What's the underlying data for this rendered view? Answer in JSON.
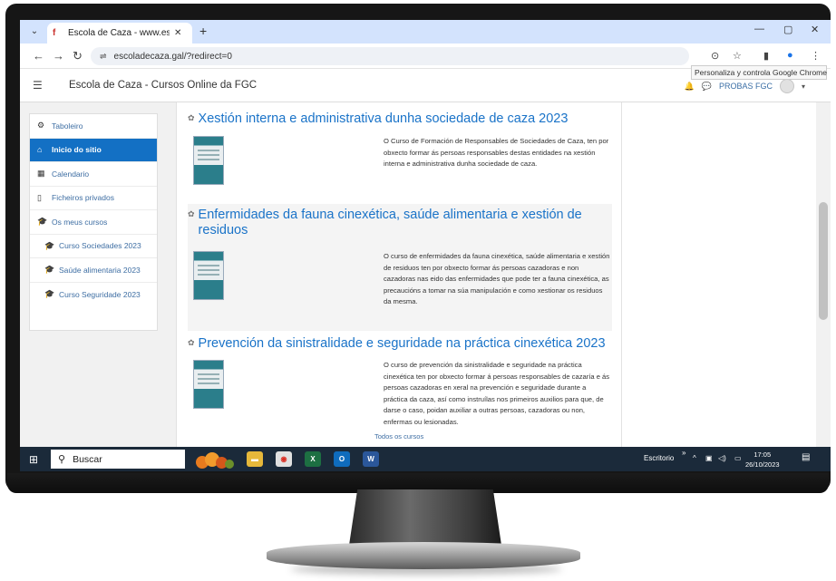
{
  "browser": {
    "tab_title": "Escola de Caza - www.escolad",
    "url": "escoladecaza.gal/?redirect=0",
    "tooltip": "Personaliza y controla Google Chrome"
  },
  "navbar": {
    "site_name": "Escola de Caza - Cursos Online da FGC",
    "user": "PROBAS FGC"
  },
  "sidebar": {
    "items": [
      {
        "label": "Taboleiro",
        "icon": "dashboard-icon"
      },
      {
        "label": "Inicio do sitio",
        "icon": "home-icon"
      },
      {
        "label": "Calendario",
        "icon": "calendar-icon"
      },
      {
        "label": "Ficheiros privados",
        "icon": "file-icon"
      },
      {
        "label": "Os meus cursos",
        "icon": "graduation-cap-icon"
      },
      {
        "label": "Curso Sociedades 2023",
        "icon": "graduation-cap-icon"
      },
      {
        "label": "Saúde alimentaria 2023",
        "icon": "graduation-cap-icon"
      },
      {
        "label": "Curso Seguridade 2023",
        "icon": "graduation-cap-icon"
      }
    ]
  },
  "courses": [
    {
      "title": "Xestión interna e administrativa dunha sociedade de caza 2023",
      "summary": "O Curso de Formación de Responsables de Sociedades de Caza, ten por obxecto formar ás persoas responsables destas entidades na xestión interna e administrativa dunha sociedade de caza."
    },
    {
      "title": "Enfermidades da fauna cinexética, saúde alimentaria e xestión de residuos",
      "summary": "O curso de enfermidades da fauna cinexética, saúde alimentaria e xestión de residuos ten por obxecto formar ás persoas cazadoras e non cazadoras nas eido das enfermidades que pode ter a fauna cinexética, as precaucións a tomar na súa manipulación e como xestionar os residuos da mesma."
    },
    {
      "title": "Prevención da sinistralidade e seguridade na práctica cinexética 2023",
      "summary": "O curso de prevención da sinistralidade e seguridade na práctica cinexética ten por obxecto formar á persoas responsables de cazaría e ás persoas cazadoras en xeral na prevención e seguridade durante a práctica da caza, así como instruílas nos primeiros auxilios para que, de darse o caso, poidan auxiliar a outras persoas, cazadoras ou non, enfermas ou lesionadas."
    }
  ],
  "all_courses_link": "Todos os cursos",
  "taskbar": {
    "search_label": "Buscar",
    "desktop_label": "Escritorio",
    "time": "17:05",
    "date": "26/10/2023"
  },
  "colors": {
    "link_blue": "#1a73c8",
    "active_nav": "#1370c4",
    "chrome_tabstrip": "#d3e3fd",
    "taskbar": "#1b2a3a"
  }
}
